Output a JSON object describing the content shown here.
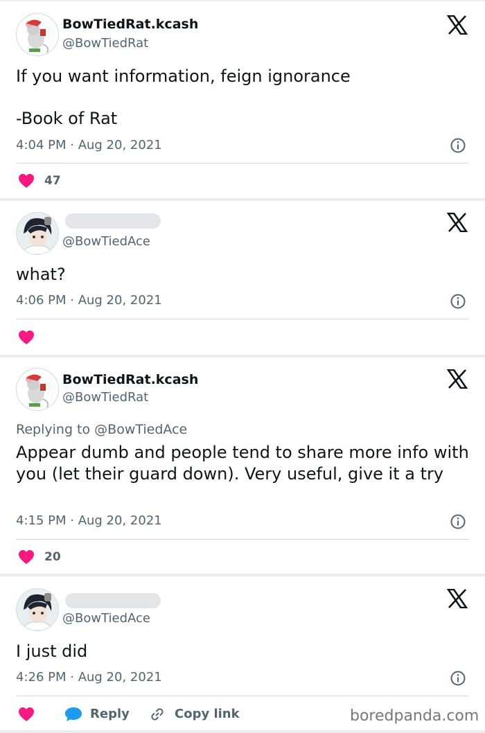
{
  "tweets": [
    {
      "name": "BowTiedRat.kcash",
      "handle": "@BowTiedRat",
      "text_lines": [
        "If you want information, feign ignorance",
        "-Book of Rat"
      ],
      "time": "4:04 PM · Aug 20, 2021",
      "likes": "47",
      "avatar": "rat-avatar"
    },
    {
      "handle": "@BowTiedAce",
      "text_lines": [
        "what?"
      ],
      "time": "4:06 PM · Aug 20, 2021",
      "avatar": "ace-avatar"
    },
    {
      "name": "BowTiedRat.kcash",
      "handle": "@BowTiedRat",
      "replying": "Replying to @BowTiedAce",
      "text_lines": [
        "Appear dumb and people tend to share more info with you (let their guard down). Very useful, give it a try"
      ],
      "time": "4:15 PM · Aug 20, 2021",
      "likes": "20",
      "avatar": "rat-avatar"
    },
    {
      "handle": "@BowTiedAce",
      "text_lines": [
        "I just did"
      ],
      "time": "4:26 PM · Aug 20, 2021",
      "avatar": "ace-avatar",
      "actions": {
        "reply": "Reply",
        "copy_link": "Copy link"
      }
    }
  ],
  "watermark": "boredpanda.com",
  "colors": {
    "heart": "#f91880",
    "reply": "#1d9bf0",
    "muted": "#536471",
    "text": "#0f1419"
  },
  "icons": [
    "x-logo-icon",
    "info-icon",
    "heart-icon",
    "reply-bubble-icon",
    "link-icon"
  ]
}
